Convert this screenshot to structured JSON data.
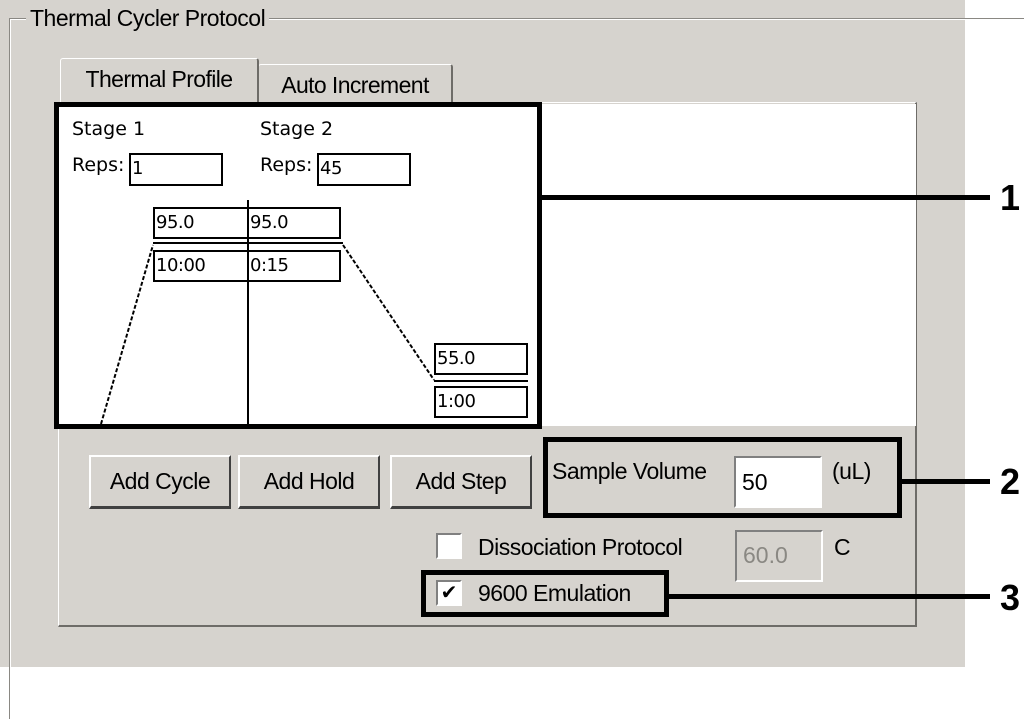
{
  "groupbox": {
    "title": "Thermal Cycler Protocol"
  },
  "tabs": [
    {
      "label": "Thermal Profile",
      "active": true
    },
    {
      "label": "Auto Increment",
      "active": false
    }
  ],
  "stages": [
    {
      "label": "Stage 1",
      "reps_label": "Reps:",
      "reps": "1",
      "steps": [
        {
          "temp": "95.0",
          "time": "10:00"
        }
      ]
    },
    {
      "label": "Stage 2",
      "reps_label": "Reps:",
      "reps": "45",
      "steps": [
        {
          "temp": "95.0",
          "time": "0:15"
        },
        {
          "temp": "55.0",
          "time": "1:00"
        }
      ]
    }
  ],
  "buttons": {
    "add_cycle": "Add Cycle",
    "add_hold": "Add Hold",
    "add_step": "Add Step"
  },
  "sample_volume": {
    "label": "Sample Volume",
    "value": "50",
    "unit": "(uL)"
  },
  "dissociation": {
    "label": "Dissociation Protocol",
    "checked": false,
    "value": "60.0",
    "unit": "C"
  },
  "emulation": {
    "label": "9600 Emulation",
    "checked": true,
    "check_glyph": "✔"
  },
  "callouts": [
    "1",
    "2",
    "3"
  ],
  "colors": {
    "dialog": "#d6d3ce",
    "highlight": "#000000"
  }
}
